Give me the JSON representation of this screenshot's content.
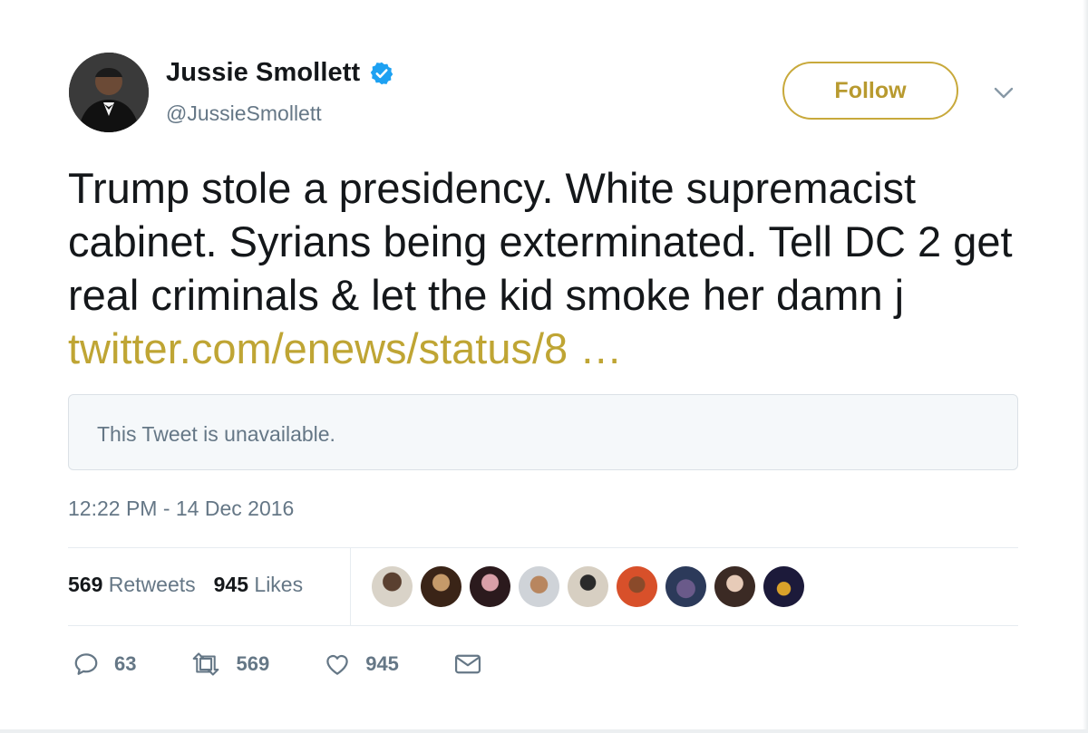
{
  "author": {
    "name": "Jussie Smollett",
    "handle": "@JussieSmollett",
    "verified_icon": "verified-badge-icon"
  },
  "follow_label": "Follow",
  "tweet": {
    "text": "Trump stole a presidency. White supremacist cabinet. Syrians being exterminated. Tell DC 2 get real criminals & let the kid smoke her damn j ",
    "link": "twitter.com/enews/status/8 …"
  },
  "quoted_unavailable": "This Tweet is unavailable.",
  "timestamp": "12:22 PM - 14 Dec 2016",
  "stats": {
    "retweets_count": "569",
    "retweets_label": "Retweets",
    "likes_count": "945",
    "likes_label": "Likes"
  },
  "actions": {
    "reply_count": "63",
    "retweet_count": "569",
    "like_count": "945"
  },
  "colors": {
    "accent": "#bfa534",
    "text": "#14171a",
    "muted": "#657786",
    "verified": "#1da1f2"
  }
}
